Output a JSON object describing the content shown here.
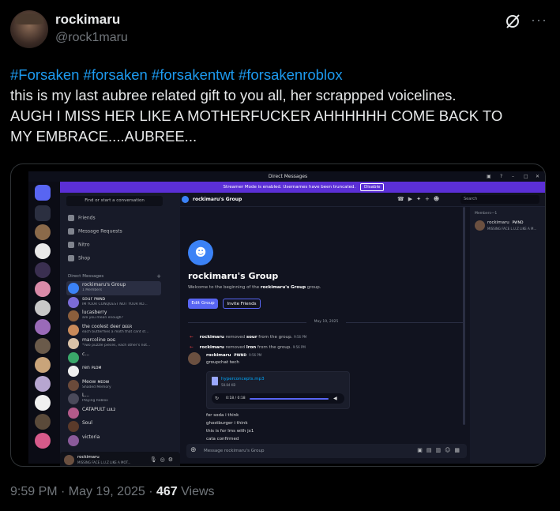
{
  "post": {
    "display_name": "rockimaru",
    "handle": "@rock1maru",
    "hashtags": "#Forsaken #forsaken #forsakentwt #forsakenroblox",
    "body_line1": "this is my last aubree related gift to you all, her scrappped voicelines.",
    "body_line2": "AUGH I MISS HER LIKE A MOTHERFUCKER AHHHHHH COME BACK TO",
    "body_line3": "MY EMBRACE....AUBREE...",
    "timestamp": "9:59 PM · May 19, 2025 · ",
    "views_count": "467",
    "views_label": " Views",
    "more_icon": "···"
  },
  "discord": {
    "window_title": "Direct Messages",
    "banner_text": "Streamer Mode is enabled. Usernames have been truncated.",
    "banner_button": "Disable",
    "find_placeholder": "Find or start a conversation",
    "nav": [
      {
        "label": "Friends",
        "icon": "friends-icon"
      },
      {
        "label": "Message Requests",
        "icon": "inbox-icon"
      },
      {
        "label": "Nitro",
        "icon": "nitro-icon"
      },
      {
        "label": "Shop",
        "icon": "shop-icon"
      }
    ],
    "dm_header": "Direct Messages",
    "dm_header_plus": "+",
    "dms": [
      {
        "name": "rockimaru's Group",
        "sub": "1 Members",
        "color": "#3b82f6",
        "tag": ""
      },
      {
        "name": "sour",
        "sub": "IM YOUR CONQUEST NOT YOUR KO...",
        "color": "#7b6bd6",
        "tag": "PWND"
      },
      {
        "name": "lucasberry",
        "sub": "are you mean enough?",
        "color": "#8b5e3c",
        "tag": ""
      },
      {
        "name": "the coolest deer",
        "sub": "each butterflies a moth that cant st...",
        "color": "#c98a5a",
        "tag": "DEER"
      },
      {
        "name": "marcoline",
        "sub": "*Two puzzle pieces, each other's not...",
        "color": "#d9c2a8",
        "tag": "DOG"
      },
      {
        "name": "c...",
        "sub": "",
        "color": "#3aa86a",
        "tag": ""
      },
      {
        "name": "ren",
        "sub": "",
        "color": "#eeeeee",
        "tag": "PLOM"
      },
      {
        "name": "Meow",
        "sub": "Shaded Memory",
        "color": "#6a4a3a",
        "tag": "MEOW"
      },
      {
        "name": "L...",
        "sub": "Playing Roblox",
        "color": "#4a4a5a",
        "tag": ""
      },
      {
        "name": "CATAPULT",
        "sub": "",
        "color": "#b35a8a",
        "tag": "LUL2"
      },
      {
        "name": "Soul",
        "sub": "",
        "color": "#5a3a2a",
        "tag": ""
      },
      {
        "name": "victoria",
        "sub": "",
        "color": "#8a5a9a",
        "tag": ""
      }
    ],
    "user": {
      "name": "rockimaru",
      "status": "MISSING FACE L.U.Z LIKE A MOT..."
    },
    "channel_name": "rockimaru's Group",
    "search_placeholder": "Search",
    "welcome_title": "rockimaru's Group",
    "welcome_pre": "Welcome to the beginning of the ",
    "welcome_bold": "rockimaru's Group",
    "welcome_post": " group.",
    "edit_group": "Edit Group",
    "invite_friends": "Invite Friends",
    "date_sep": "May 19, 2025",
    "sys1": {
      "who": "rockimaru",
      "mid": " removed ",
      "target": "sour",
      "end": " from the group. ",
      "time": "9:56 PM"
    },
    "sys2": {
      "who": "rockimaru",
      "mid": " removed ",
      "target": "lron",
      "end": " from the group. ",
      "time": "9:56 PM"
    },
    "msg_author": "rockimaru",
    "msg_tag": "PWND",
    "msg_time": "9:56 PM",
    "msg_line": "groupchat tech",
    "attachment_name": "hyperconcepts.mp3",
    "attachment_size": "58.84 KB",
    "player_time": "0:18 / 0:18",
    "lines": [
      "for soda i think",
      "ghostburger i think",
      "this is for lms with jx1",
      "cata confirmed"
    ],
    "composer_placeholder": "Message rockimaru's Group",
    "members_header": "Members—1",
    "member_name": "rockimaru",
    "member_tag": "PWND",
    "member_status": "MISSING FACE L.U.Z LIKE A M..."
  }
}
